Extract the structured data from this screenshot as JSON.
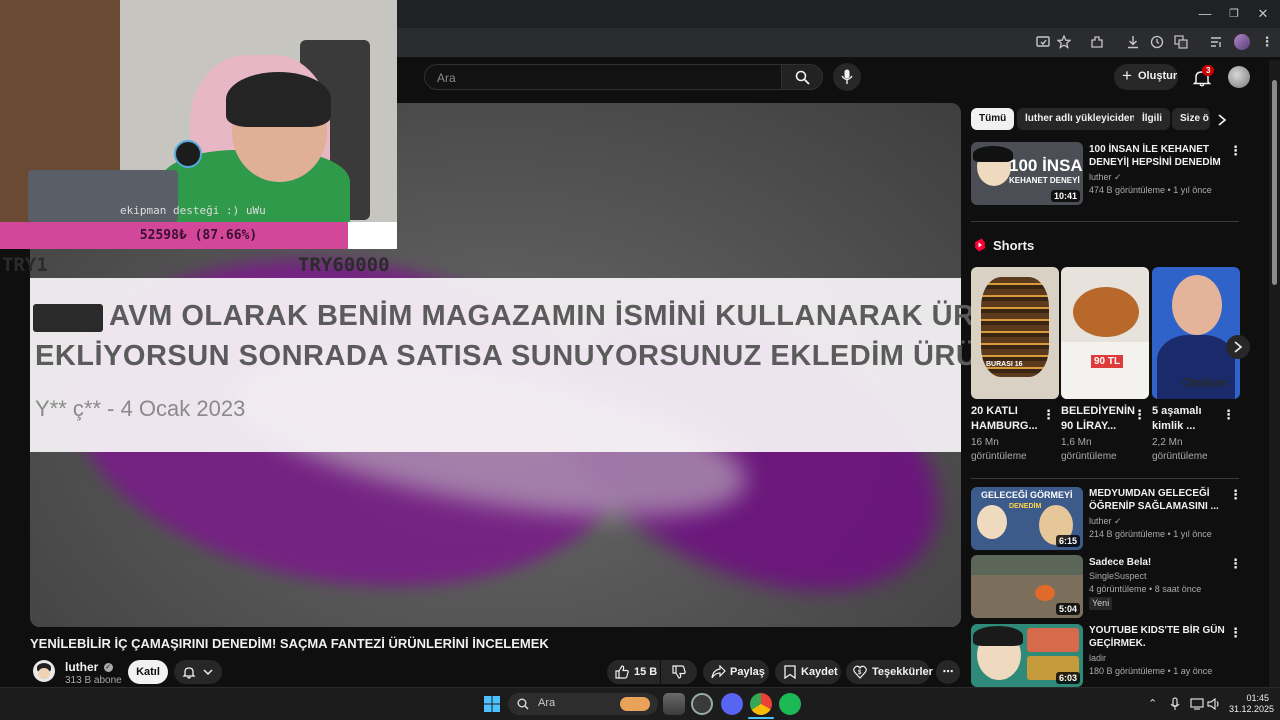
{
  "browser": {
    "window_controls": [
      "—",
      "❐",
      "✕"
    ],
    "toolbar_icons": [
      "install-icon",
      "star-icon",
      "extensions-icon",
      "download-icon",
      "history-icon",
      "translate-icon",
      "media-icon",
      "profile-icon",
      "menu-icon"
    ]
  },
  "youtube": {
    "search_placeholder": "Ara",
    "create_label": "Oluştur",
    "notification_count": "3"
  },
  "overlay": {
    "webcam_caption": "ekipman desteği :) uWu",
    "donation_text": "52598₺ (87.66%)",
    "donation_progress": 0.8766,
    "goal_min": "TRY1",
    "goal_max": "TRY60000"
  },
  "video": {
    "review_line1": "AVM OLARAK BENİM MAGAZAMIN İSMİNİ KULLANARAK ÜRÜN",
    "review_line2": "EKLİYORSUN SONRADA SATISA SUNUYORSUNUZ EKLEDİM ÜRÜN...",
    "review_meta": "Y** ç** - 4 Ocak 2023",
    "title": "YENİLEBİLİR İÇ ÇAMAŞIRINI DENEDİM! SAÇMA FANTEZİ ÜRÜNLERİNİ İNCELEMEK",
    "channel": "luther",
    "subscribers": "313 B abone",
    "join_label": "Katıl",
    "like_count": "15 B",
    "share_label": "Paylaş",
    "save_label": "Kaydet",
    "thanks_label": "Teşekkürler"
  },
  "sidebar": {
    "chips": [
      "Tümü",
      "luther adlı yükleyiciden",
      "İlgili",
      "Size ö"
    ],
    "shorts_heading": "Shorts",
    "related": [
      {
        "title": "100 İNSAN İLE KEHANET DENEYİ| HEPSİNİ DENEDİM",
        "channel": "luther",
        "meta": "474 B görüntüleme • 1 yıl önce",
        "duration": "10:41",
        "thumb_text1": "100 İNSAN",
        "thumb_text2": "KEHANET DENEYİ"
      },
      {
        "title": "MEDYUMDAN GELECEĞİ ÖĞRENİP SAĞLAMASINI ...",
        "channel": "luther",
        "meta": "214 B görüntüleme • 1 yıl önce",
        "duration": "6:15",
        "thumb_text1": "GELECEĞİ GÖRMEYİ",
        "thumb_text2": "DENEDİM"
      },
      {
        "title": "Sadece Bela!",
        "channel": "SingleSuspect",
        "meta": "4 görüntüleme • 8 saat önce",
        "badge": "Yeni",
        "duration": "5:04"
      },
      {
        "title": "YOUTUBE KIDS'TE BİR GÜN GEÇİRMEK.",
        "channel": "ladir",
        "meta": "180 B görüntüleme • 1 ay önce",
        "duration": "6:03"
      }
    ],
    "shorts": [
      {
        "title": "20 KATLI HAMBURG...",
        "views": "16 Mn görüntüleme",
        "thumb_text": "BURASI 16"
      },
      {
        "title": "BELEDİYENİN 90 LİRAY...",
        "views": "1,6 Mn görüntüleme",
        "thumb_text": "90 TL"
      },
      {
        "title": "5 aşamalı kimlik ...",
        "views": "2,2 Mn görüntüleme",
        "thumb_text": "Otokon"
      }
    ]
  },
  "taskbar": {
    "search_placeholder": "Ara",
    "time": "01:45",
    "date": "31.12.2025"
  }
}
